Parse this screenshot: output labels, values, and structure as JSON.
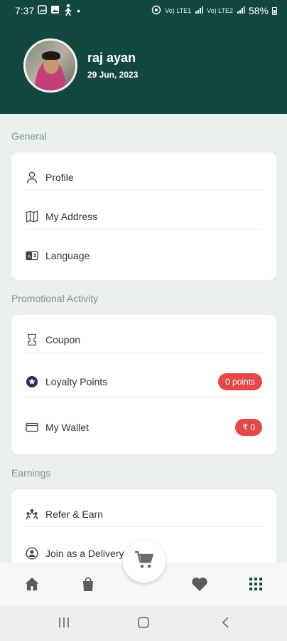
{
  "status_bar": {
    "time": "7:37",
    "battery": "58%",
    "dot": "•",
    "net1": "Vo) LTE1",
    "net2": "Vo) LTE2"
  },
  "profile": {
    "name": "raj ayan",
    "date": "29 Jun, 2023"
  },
  "sections": {
    "general": "General",
    "promotional": "Promotional Activity",
    "earnings": "Earnings"
  },
  "general_items": {
    "profile": "Profile",
    "address": "My Address",
    "language": "Language"
  },
  "promo_items": {
    "coupon": "Coupon",
    "loyalty": "Loyalty Points",
    "loyalty_badge": "0 points",
    "wallet": "My Wallet",
    "wallet_badge": "₹ 0"
  },
  "earning_items": {
    "refer": "Refer & Earn",
    "delivery": "Join as a Delivery Man"
  },
  "icons": {
    "profile": "person-outline-icon",
    "address": "map-icon",
    "language": "language-icon",
    "coupon": "coupon-icon",
    "loyalty": "star-badge-icon",
    "wallet": "wallet-icon",
    "refer": "people-icon",
    "delivery": "delivery-person-icon"
  },
  "colors": {
    "header_bg": "#134840",
    "badge": "#e54848",
    "section_title": "#7d9a90",
    "page_bg": "#e9efec"
  }
}
